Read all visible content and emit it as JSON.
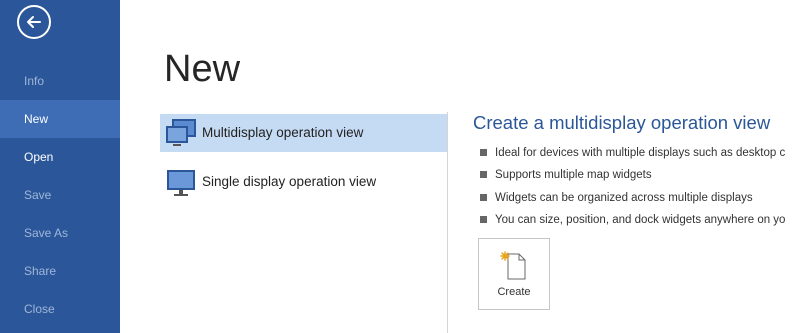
{
  "sidebar": {
    "back_icon": "arrow-left-icon",
    "items": [
      {
        "label": "Info"
      },
      {
        "label": "New"
      },
      {
        "label": "Open"
      },
      {
        "label": "Save"
      },
      {
        "label": "Save As"
      },
      {
        "label": "Share"
      },
      {
        "label": "Close"
      }
    ],
    "active": "New",
    "color": "#2b579a",
    "active_color": "#3e6db5"
  },
  "main": {
    "title": "New",
    "options": [
      {
        "label": "Multidisplay operation view",
        "icon": "multi-monitor-icon",
        "selected": true
      },
      {
        "label": "Single display operation view",
        "icon": "monitor-icon",
        "selected": false
      }
    ],
    "detail": {
      "title": "Create a multidisplay operation view",
      "features": [
        "Ideal for devices with multiple displays such as desktop c",
        "Supports multiple map widgets",
        "Widgets can be organized across multiple displays",
        "You can size, position, and dock widgets anywhere on yo"
      ],
      "create_label": "Create",
      "create_icon": "new-document-icon"
    },
    "accent_color": "#2b579a",
    "selection_color": "#c5dbf3"
  }
}
